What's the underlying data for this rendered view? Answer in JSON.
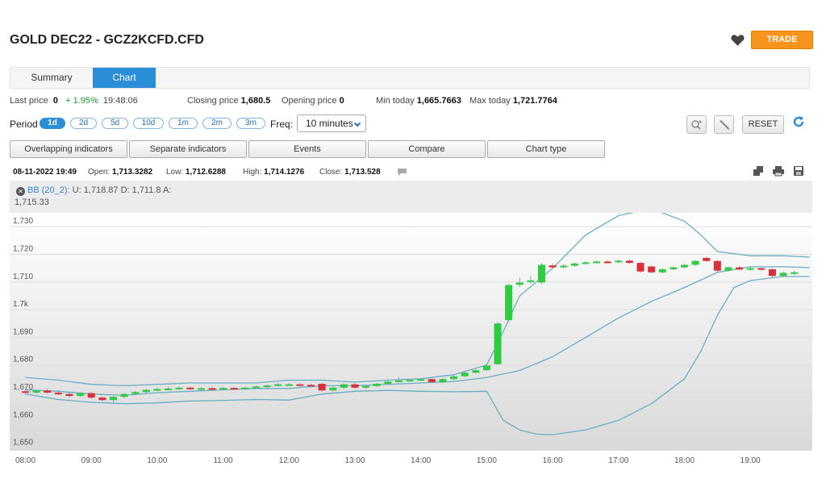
{
  "header": {
    "title": "GOLD DEC22 - GCZ2KCFD.CFD",
    "trade_label": "TRADE",
    "favorite_icon": "heart-icon"
  },
  "tabs": [
    {
      "label": "Summary",
      "active": false
    },
    {
      "label": "Chart",
      "active": true
    }
  ],
  "price_bar": {
    "last_price_label": "Last price",
    "last_price_value": "0",
    "change": "+ 1.95%",
    "time": "19:48:06",
    "closing_label": "Closing price",
    "closing_value": "1,680.5",
    "opening_label": "Opening price",
    "opening_value": "0",
    "min_label": "Min today",
    "min_value": "1,665.7663",
    "max_label": "Max today",
    "max_value": "1,721.7764"
  },
  "period": {
    "label": "Period",
    "options": [
      "1d",
      "2d",
      "5d",
      "10d",
      "1m",
      "2m",
      "3m"
    ],
    "selected": "1d",
    "freq_label": "Freq:",
    "freq_value": "10 minutes"
  },
  "tools": {
    "reset_label": "RESET",
    "zoom_icon": "zoom-icon",
    "draw_icon": "pencil-icon",
    "refresh_icon": "refresh-icon"
  },
  "indicator_buttons": [
    "Overlapping indicators",
    "Separate indicators",
    "Events",
    "Compare",
    "Chart type"
  ],
  "ohlc": {
    "datetime": "08-11-2022 19:49",
    "open_label": "Open:",
    "open_value": "1,713.3282",
    "low_label": "Low:",
    "low_value": "1,712.6288",
    "high_label": "High:",
    "high_value": "1,714.1276",
    "close_label": "Close:",
    "close_value": "1,713.528"
  },
  "bb": {
    "name": "BB (20_2):",
    "values": "U: 1,718.87 D: 1,711.8 A:",
    "avg": "1,715.33"
  },
  "chart_data": {
    "type": "candlestick",
    "x_ticks": [
      "08:00",
      "09:00",
      "10:00",
      "11:00",
      "12:00",
      "13:00",
      "14:00",
      "15:00",
      "16:00",
      "17:00",
      "18:00",
      "19:00"
    ],
    "y_ticks": [
      {
        "value": 1650,
        "label": "1,650"
      },
      {
        "value": 1660,
        "label": "1,660"
      },
      {
        "value": 1670,
        "label": "1,670"
      },
      {
        "value": 1680,
        "label": "1,680"
      },
      {
        "value": 1690,
        "label": "1,690"
      },
      {
        "value": 1700,
        "label": "1.7k"
      },
      {
        "value": 1710,
        "label": "1,710"
      },
      {
        "value": 1720,
        "label": "1,720"
      },
      {
        "value": 1730,
        "label": "1,730"
      }
    ],
    "ylim": [
      1649,
      1735
    ],
    "xlim_hours": [
      8.0,
      20.0
    ],
    "colors": {
      "up": "#2ecc40",
      "down": "#d9303a",
      "band": "#6aaec4",
      "grid": "#dddddd"
    },
    "candles": [
      {
        "t": "08:00",
        "o": 1670.5,
        "c": 1670.0,
        "h": 1671.5,
        "l": 1669.2
      },
      {
        "t": "08:10",
        "o": 1670.0,
        "c": 1670.8,
        "h": 1671.2,
        "l": 1669.5
      },
      {
        "t": "08:20",
        "o": 1670.8,
        "c": 1670.0,
        "h": 1671.5,
        "l": 1669.6
      },
      {
        "t": "08:30",
        "o": 1670.0,
        "c": 1669.5,
        "h": 1670.8,
        "l": 1668.9
      },
      {
        "t": "08:40",
        "o": 1669.5,
        "c": 1668.8,
        "h": 1670.2,
        "l": 1668.2
      },
      {
        "t": "08:50",
        "o": 1668.8,
        "c": 1669.8,
        "h": 1670.2,
        "l": 1668.5
      },
      {
        "t": "09:00",
        "o": 1669.8,
        "c": 1668.2,
        "h": 1670.2,
        "l": 1667.7
      },
      {
        "t": "09:10",
        "o": 1668.2,
        "c": 1667.3,
        "h": 1668.7,
        "l": 1666.8
      },
      {
        "t": "09:20",
        "o": 1667.3,
        "c": 1668.5,
        "h": 1668.8,
        "l": 1666.5
      },
      {
        "t": "09:30",
        "o": 1668.5,
        "c": 1669.5,
        "h": 1669.8,
        "l": 1668.0
      },
      {
        "t": "09:40",
        "o": 1669.5,
        "c": 1670.2,
        "h": 1670.6,
        "l": 1669.0
      },
      {
        "t": "09:50",
        "o": 1670.2,
        "c": 1671.0,
        "h": 1671.4,
        "l": 1669.8
      },
      {
        "t": "10:00",
        "o": 1671.0,
        "c": 1671.3,
        "h": 1671.8,
        "l": 1670.6
      },
      {
        "t": "10:10",
        "o": 1671.3,
        "c": 1671.5,
        "h": 1672.0,
        "l": 1670.8
      },
      {
        "t": "10:20",
        "o": 1671.5,
        "c": 1671.8,
        "h": 1672.2,
        "l": 1671.1
      },
      {
        "t": "10:30",
        "o": 1671.8,
        "c": 1671.3,
        "h": 1672.2,
        "l": 1670.9
      },
      {
        "t": "10:40",
        "o": 1671.3,
        "c": 1671.6,
        "h": 1672.0,
        "l": 1670.9
      },
      {
        "t": "10:50",
        "o": 1671.6,
        "c": 1671.2,
        "h": 1672.0,
        "l": 1670.8
      },
      {
        "t": "11:00",
        "o": 1671.2,
        "c": 1671.7,
        "h": 1672.1,
        "l": 1670.8
      },
      {
        "t": "11:10",
        "o": 1671.7,
        "c": 1671.4,
        "h": 1672.0,
        "l": 1671.0
      },
      {
        "t": "11:20",
        "o": 1671.4,
        "c": 1671.8,
        "h": 1672.2,
        "l": 1671.0
      },
      {
        "t": "11:30",
        "o": 1671.8,
        "c": 1672.2,
        "h": 1672.6,
        "l": 1671.4
      },
      {
        "t": "11:40",
        "o": 1672.2,
        "c": 1672.6,
        "h": 1673.0,
        "l": 1671.8
      },
      {
        "t": "11:50",
        "o": 1672.6,
        "c": 1673.0,
        "h": 1673.4,
        "l": 1672.2
      },
      {
        "t": "12:00",
        "o": 1673.0,
        "c": 1673.0,
        "h": 1673.5,
        "l": 1672.6
      },
      {
        "t": "12:10",
        "o": 1673.0,
        "c": 1672.8,
        "h": 1673.4,
        "l": 1672.4
      },
      {
        "t": "12:20",
        "o": 1672.8,
        "c": 1672.6,
        "h": 1673.2,
        "l": 1672.2
      },
      {
        "t": "12:30",
        "o": 1673.2,
        "c": 1670.8,
        "h": 1673.6,
        "l": 1670.3
      },
      {
        "t": "12:40",
        "o": 1670.8,
        "c": 1671.8,
        "h": 1672.2,
        "l": 1670.4
      },
      {
        "t": "12:50",
        "o": 1671.8,
        "c": 1673.0,
        "h": 1673.4,
        "l": 1671.4
      },
      {
        "t": "13:00",
        "o": 1673.0,
        "c": 1671.8,
        "h": 1673.4,
        "l": 1671.4
      },
      {
        "t": "13:10",
        "o": 1671.8,
        "c": 1672.4,
        "h": 1672.8,
        "l": 1671.4
      },
      {
        "t": "13:20",
        "o": 1672.4,
        "c": 1673.2,
        "h": 1673.6,
        "l": 1672.0
      },
      {
        "t": "13:30",
        "o": 1673.2,
        "c": 1674.0,
        "h": 1674.5,
        "l": 1672.8
      },
      {
        "t": "13:40",
        "o": 1674.0,
        "c": 1674.4,
        "h": 1675.6,
        "l": 1673.6
      },
      {
        "t": "13:50",
        "o": 1674.4,
        "c": 1674.6,
        "h": 1675.0,
        "l": 1674.0
      },
      {
        "t": "14:00",
        "o": 1674.6,
        "c": 1674.9,
        "h": 1675.3,
        "l": 1674.2
      },
      {
        "t": "14:10",
        "o": 1674.9,
        "c": 1673.8,
        "h": 1675.3,
        "l": 1673.4
      },
      {
        "t": "14:20",
        "o": 1673.8,
        "c": 1674.9,
        "h": 1675.3,
        "l": 1673.4
      },
      {
        "t": "14:30",
        "o": 1674.9,
        "c": 1675.9,
        "h": 1676.3,
        "l": 1674.5
      },
      {
        "t": "14:40",
        "o": 1675.9,
        "c": 1677.2,
        "h": 1677.6,
        "l": 1675.5
      },
      {
        "t": "14:50",
        "o": 1677.2,
        "c": 1678.1,
        "h": 1678.5,
        "l": 1676.8
      },
      {
        "t": "15:00",
        "o": 1678.1,
        "c": 1679.8,
        "h": 1680.3,
        "l": 1677.8
      },
      {
        "t": "15:10",
        "o": 1680.3,
        "c": 1695.0,
        "h": 1695.6,
        "l": 1680.0
      },
      {
        "t": "15:20",
        "o": 1696.2,
        "c": 1708.9,
        "h": 1709.4,
        "l": 1695.7
      },
      {
        "t": "15:30",
        "o": 1709.0,
        "c": 1709.8,
        "h": 1711.6,
        "l": 1708.2
      },
      {
        "t": "15:40",
        "o": 1710.0,
        "c": 1710.6,
        "h": 1712.0,
        "l": 1709.5
      },
      {
        "t": "15:50",
        "o": 1709.8,
        "c": 1716.2,
        "h": 1716.8,
        "l": 1709.2
      },
      {
        "t": "16:00",
        "o": 1716.0,
        "c": 1715.3,
        "h": 1716.8,
        "l": 1714.9
      },
      {
        "t": "16:10",
        "o": 1715.3,
        "c": 1715.9,
        "h": 1716.6,
        "l": 1714.9
      },
      {
        "t": "16:20",
        "o": 1715.9,
        "c": 1716.7,
        "h": 1717.1,
        "l": 1715.5
      },
      {
        "t": "16:30",
        "o": 1716.7,
        "c": 1717.1,
        "h": 1717.6,
        "l": 1716.3
      },
      {
        "t": "16:40",
        "o": 1717.1,
        "c": 1717.4,
        "h": 1717.9,
        "l": 1716.7
      },
      {
        "t": "16:50",
        "o": 1717.4,
        "c": 1717.2,
        "h": 1717.9,
        "l": 1716.8
      },
      {
        "t": "17:00",
        "o": 1717.2,
        "c": 1717.7,
        "h": 1718.2,
        "l": 1716.8
      },
      {
        "t": "17:10",
        "o": 1717.7,
        "c": 1716.9,
        "h": 1718.2,
        "l": 1716.5
      },
      {
        "t": "17:20",
        "o": 1716.9,
        "c": 1713.8,
        "h": 1717.3,
        "l": 1713.3
      },
      {
        "t": "17:30",
        "o": 1715.6,
        "c": 1713.5,
        "h": 1716.0,
        "l": 1713.1
      },
      {
        "t": "17:40",
        "o": 1713.5,
        "c": 1714.6,
        "h": 1715.0,
        "l": 1713.1
      },
      {
        "t": "17:50",
        "o": 1714.6,
        "c": 1715.3,
        "h": 1715.7,
        "l": 1714.2
      },
      {
        "t": "18:00",
        "o": 1715.3,
        "c": 1716.2,
        "h": 1716.6,
        "l": 1714.9
      },
      {
        "t": "18:10",
        "o": 1716.2,
        "c": 1717.6,
        "h": 1718.0,
        "l": 1715.8
      },
      {
        "t": "18:20",
        "o": 1718.7,
        "c": 1717.6,
        "h": 1719.1,
        "l": 1717.2
      },
      {
        "t": "18:30",
        "o": 1717.6,
        "c": 1714.1,
        "h": 1718.0,
        "l": 1713.6
      },
      {
        "t": "18:40",
        "o": 1714.1,
        "c": 1715.3,
        "h": 1715.7,
        "l": 1713.7
      },
      {
        "t": "18:50",
        "o": 1715.3,
        "c": 1714.5,
        "h": 1715.8,
        "l": 1714.1
      },
      {
        "t": "19:00",
        "o": 1714.5,
        "c": 1715.0,
        "h": 1715.5,
        "l": 1714.0
      },
      {
        "t": "19:10",
        "o": 1715.0,
        "c": 1714.6,
        "h": 1715.5,
        "l": 1714.1
      },
      {
        "t": "19:20",
        "o": 1714.6,
        "c": 1712.2,
        "h": 1715.0,
        "l": 1711.6
      },
      {
        "t": "19:30",
        "o": 1712.2,
        "c": 1713.3,
        "h": 1713.8,
        "l": 1711.7
      },
      {
        "t": "19:40",
        "o": 1713.3,
        "c": 1713.5,
        "h": 1714.1,
        "l": 1712.6
      }
    ],
    "bb_upper": [
      [
        8.0,
        1675.5
      ],
      [
        8.5,
        1674.5
      ],
      [
        9.0,
        1673.0
      ],
      [
        9.5,
        1672.5
      ],
      [
        10.0,
        1673.0
      ],
      [
        10.5,
        1673.5
      ],
      [
        11.0,
        1673.5
      ],
      [
        11.5,
        1673.5
      ],
      [
        12.0,
        1674.5
      ],
      [
        12.5,
        1674.5
      ],
      [
        13.0,
        1673.8
      ],
      [
        13.5,
        1674.5
      ],
      [
        14.0,
        1675.0
      ],
      [
        14.5,
        1676.5
      ],
      [
        15.0,
        1680.0
      ],
      [
        15.25,
        1692.0
      ],
      [
        15.5,
        1705.0
      ],
      [
        16.0,
        1715.0
      ],
      [
        16.5,
        1727.0
      ],
      [
        17.0,
        1734.0
      ],
      [
        17.5,
        1736.5
      ],
      [
        18.0,
        1732.0
      ],
      [
        18.25,
        1727.0
      ],
      [
        18.5,
        1721.0
      ],
      [
        19.0,
        1719.5
      ],
      [
        19.5,
        1719.5
      ],
      [
        19.9,
        1719.0
      ]
    ],
    "bb_lower": [
      [
        8.0,
        1669.5
      ],
      [
        8.5,
        1667.5
      ],
      [
        9.0,
        1666.5
      ],
      [
        9.5,
        1666.0
      ],
      [
        10.0,
        1666.3
      ],
      [
        10.5,
        1667.0
      ],
      [
        11.0,
        1667.2
      ],
      [
        11.5,
        1667.5
      ],
      [
        12.0,
        1667.3
      ],
      [
        12.5,
        1669.5
      ],
      [
        13.0,
        1670.5
      ],
      [
        13.5,
        1670.8
      ],
      [
        14.0,
        1670.5
      ],
      [
        14.5,
        1670.3
      ],
      [
        15.0,
        1670.5
      ],
      [
        15.25,
        1660.0
      ],
      [
        15.5,
        1656.5
      ],
      [
        15.75,
        1655.0
      ],
      [
        16.0,
        1654.8
      ],
      [
        16.5,
        1656.5
      ],
      [
        17.0,
        1660.0
      ],
      [
        17.5,
        1666.0
      ],
      [
        18.0,
        1675.0
      ],
      [
        18.25,
        1685.0
      ],
      [
        18.5,
        1698.0
      ],
      [
        18.75,
        1708.0
      ],
      [
        19.0,
        1710.5
      ],
      [
        19.5,
        1712.0
      ],
      [
        19.9,
        1712.0
      ]
    ],
    "bb_middle": [
      [
        8.0,
        1671.0
      ],
      [
        8.5,
        1670.5
      ],
      [
        9.0,
        1669.5
      ],
      [
        9.5,
        1669.0
      ],
      [
        10.0,
        1670.0
      ],
      [
        10.5,
        1670.5
      ],
      [
        11.0,
        1671.0
      ],
      [
        11.5,
        1671.5
      ],
      [
        12.0,
        1671.5
      ],
      [
        12.5,
        1672.5
      ],
      [
        13.0,
        1672.5
      ],
      [
        13.5,
        1673.0
      ],
      [
        14.0,
        1673.5
      ],
      [
        14.5,
        1674.0
      ],
      [
        15.0,
        1675.5
      ],
      [
        15.5,
        1678.0
      ],
      [
        16.0,
        1683.0
      ],
      [
        16.5,
        1690.0
      ],
      [
        17.0,
        1697.0
      ],
      [
        17.5,
        1703.0
      ],
      [
        18.0,
        1708.0
      ],
      [
        18.5,
        1713.5
      ],
      [
        19.0,
        1715.5
      ],
      [
        19.5,
        1715.5
      ],
      [
        19.9,
        1715.2
      ]
    ]
  }
}
